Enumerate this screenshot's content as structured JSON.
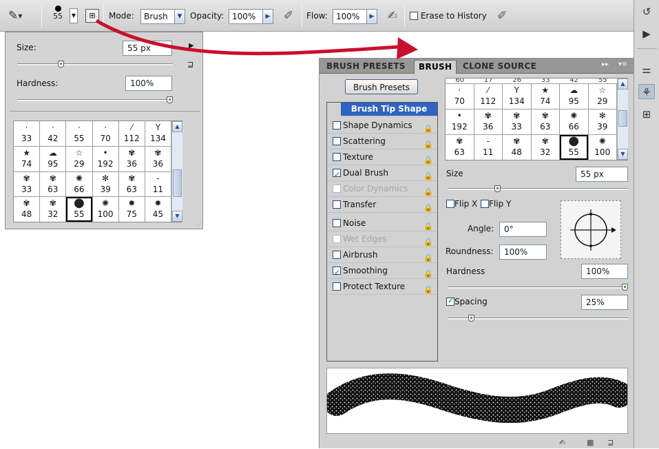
{
  "options_bar": {
    "brush_size": "55",
    "mode_label": "Mode:",
    "mode_value": "Brush",
    "opacity_label": "Opacity:",
    "opacity_value": "100%",
    "flow_label": "Flow:",
    "flow_value": "100%",
    "erase_to_history_label": "Erase to History"
  },
  "picker": {
    "size_label": "Size:",
    "size_value": "55 px",
    "hardness_label": "Hardness:",
    "hardness_value": "100%",
    "size_slider_fraction": 0.27,
    "hardness_slider_fraction": 1.0,
    "brushes": [
      {
        "num": "33",
        "g": "·"
      },
      {
        "num": "42",
        "g": "·"
      },
      {
        "num": "55",
        "g": "·"
      },
      {
        "num": "70",
        "g": "·"
      },
      {
        "num": "112",
        "g": "⁄"
      },
      {
        "num": "134",
        "g": "Y"
      },
      {
        "num": "74",
        "g": "★"
      },
      {
        "num": "95",
        "g": "☁"
      },
      {
        "num": "29",
        "g": "☆"
      },
      {
        "num": "192",
        "g": "•"
      },
      {
        "num": "36",
        "g": "✾"
      },
      {
        "num": "36",
        "g": "✾"
      },
      {
        "num": "33",
        "g": "✾"
      },
      {
        "num": "63",
        "g": "✾"
      },
      {
        "num": "66",
        "g": "✺"
      },
      {
        "num": "39",
        "g": "✻"
      },
      {
        "num": "63",
        "g": "✾"
      },
      {
        "num": "11",
        "g": "-"
      },
      {
        "num": "48",
        "g": "✾"
      },
      {
        "num": "32",
        "g": "✾"
      },
      {
        "num": "55",
        "g": "●"
      },
      {
        "num": "100",
        "g": "✺"
      },
      {
        "num": "75",
        "g": "✹"
      },
      {
        "num": "45",
        "g": "✹"
      }
    ],
    "selected_index": 20
  },
  "panel": {
    "tabs": [
      "BRUSH PRESETS",
      "BRUSH",
      "CLONE SOURCE"
    ],
    "active_tab": "BRUSH",
    "brush_presets_button": "Brush Presets",
    "options": [
      {
        "label": "Brush Tip Shape",
        "header": true
      },
      {
        "label": "Shape Dynamics",
        "checked": false,
        "disabled": false
      },
      {
        "label": "Scattering",
        "checked": false,
        "disabled": false
      },
      {
        "label": "Texture",
        "checked": false,
        "disabled": false
      },
      {
        "label": "Dual Brush",
        "checked": true,
        "disabled": false
      },
      {
        "label": "Color Dynamics",
        "checked": false,
        "disabled": true
      },
      {
        "label": "Transfer",
        "checked": false,
        "disabled": false
      },
      {
        "label": "Noise",
        "checked": false,
        "disabled": false
      },
      {
        "label": "Wet Edges",
        "checked": false,
        "disabled": true
      },
      {
        "label": "Airbrush",
        "checked": false,
        "disabled": false
      },
      {
        "label": "Smoothing",
        "checked": true,
        "disabled": false
      },
      {
        "label": "Protect Texture",
        "checked": false,
        "disabled": false
      }
    ],
    "top_row_partial": [
      "60",
      "17",
      "26",
      "33",
      "42",
      "55"
    ],
    "tips": [
      {
        "num": "70",
        "g": "·"
      },
      {
        "num": "112",
        "g": "⁄"
      },
      {
        "num": "134",
        "g": "Y"
      },
      {
        "num": "74",
        "g": "★"
      },
      {
        "num": "95",
        "g": "☁"
      },
      {
        "num": "29",
        "g": "☆"
      },
      {
        "num": "192",
        "g": "•"
      },
      {
        "num": "36",
        "g": "✾"
      },
      {
        "num": "33",
        "g": "✾"
      },
      {
        "num": "63",
        "g": "✾"
      },
      {
        "num": "66",
        "g": "✺"
      },
      {
        "num": "39",
        "g": "✻"
      },
      {
        "num": "63",
        "g": "✾"
      },
      {
        "num": "11",
        "g": "-"
      },
      {
        "num": "48",
        "g": "✾"
      },
      {
        "num": "32",
        "g": "✾"
      },
      {
        "num": "55",
        "g": "●"
      },
      {
        "num": "100",
        "g": "✺"
      }
    ],
    "selected_tip_index": 16,
    "size_label": "Size",
    "size_value": "55 px",
    "size_slider_fraction": 0.27,
    "flip_x_label": "Flip X",
    "flip_y_label": "Flip Y",
    "angle_label": "Angle:",
    "angle_value": "0°",
    "roundness_label": "Roundness:",
    "roundness_value": "100%",
    "hardness_label": "Hardness",
    "hardness_value": "100%",
    "hardness_slider_fraction": 1.0,
    "spacing_label": "Spacing",
    "spacing_checked": true,
    "spacing_value": "25%",
    "spacing_slider_fraction": 0.12
  },
  "colors": {
    "accent_arrow": "#c8102e",
    "selection_blue": "#2f63c4"
  }
}
